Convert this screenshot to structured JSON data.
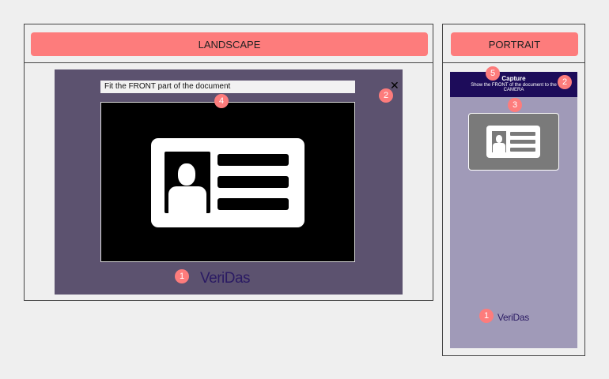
{
  "landscape": {
    "header_label": "LANDSCAPE",
    "instruction": "Fit the FRONT part of the document",
    "close_glyph": "✕",
    "brand": "VeriDas",
    "markers": {
      "brand": "1",
      "close": "2",
      "instruction": "4"
    }
  },
  "portrait": {
    "header_label": "PORTRAIT",
    "title": "Capture",
    "subtitle_line1": "Show the FRONT of the document to the",
    "subtitle_line2": "CAMERA",
    "brand": "VeriDas",
    "markers": {
      "brand": "1",
      "close": "2",
      "card": "3",
      "title": "5"
    }
  },
  "colors": {
    "accent": "#fd7c7c",
    "landscape_bg": "#5c526f",
    "portrait_bg": "#a09ab8",
    "portrait_header": "#1d0c5a",
    "brand_text": "#2a1a63"
  },
  "icons": {
    "close": "close-icon",
    "id_card": "id-card-icon"
  }
}
